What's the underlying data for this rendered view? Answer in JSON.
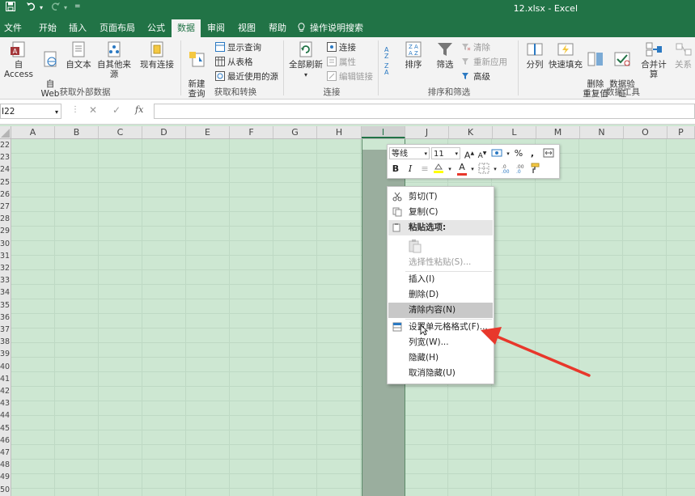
{
  "window": {
    "title": "12.xlsx  -  Excel"
  },
  "tabs": [
    {
      "label": "文件"
    },
    {
      "label": "开始"
    },
    {
      "label": "插入"
    },
    {
      "label": "页面布局"
    },
    {
      "label": "公式"
    },
    {
      "label": "数据"
    },
    {
      "label": "审阅"
    },
    {
      "label": "视图"
    },
    {
      "label": "帮助"
    },
    {
      "label": "操作说明搜索"
    }
  ],
  "active_tab": "数据",
  "ribbon": {
    "get_external": {
      "access": "自 Access",
      "web": "自\nWeb",
      "text": "自文本",
      "other": "自其他来源",
      "existing": "现有连接",
      "group_label": "获取外部数据"
    },
    "get_transform": {
      "new_query": "新建\n查询",
      "show_queries": "显示查询",
      "from_table": "从表格",
      "recent_sources": "最近使用的源",
      "group_label": "获取和转换"
    },
    "connections": {
      "refresh_all": "全部刷新",
      "connections": "连接",
      "properties": "属性",
      "edit_links": "编辑链接",
      "group_label": "连接"
    },
    "sort_filter": {
      "sort": "排序",
      "filter": "筛选",
      "clear": "清除",
      "reapply": "重新应用",
      "advanced": "高级",
      "group_label": "排序和筛选"
    },
    "data_tools": {
      "split": "分列",
      "flash_fill": "快速填充",
      "remove_dup": "删除\n重复值",
      "validation": "数据验\n证",
      "consolidate": "合并计算",
      "relationships": "关系",
      "group_label": "数据工具"
    }
  },
  "formula_bar": {
    "name_box": "I22",
    "fx": "fx"
  },
  "columns": [
    "A",
    "B",
    "C",
    "D",
    "E",
    "F",
    "G",
    "H",
    "I",
    "J",
    "K",
    "L",
    "M",
    "N",
    "O",
    "P"
  ],
  "selected_column": "I",
  "rows": [
    "22",
    "23",
    "24",
    "25",
    "26",
    "27",
    "28",
    "29",
    "30",
    "31",
    "32",
    "33",
    "34",
    "35",
    "36",
    "37",
    "38",
    "39",
    "40",
    "41",
    "42",
    "43",
    "44",
    "45",
    "46",
    "47",
    "48",
    "49",
    "50"
  ],
  "mini_toolbar": {
    "font_name": "等线",
    "font_size": "11",
    "grow": "A",
    "shrink": "A",
    "percent": "%",
    "comma": ",",
    "bold": "B",
    "italic": "I",
    "font_color_glyph": "A"
  },
  "context_menu": [
    {
      "label": "剪切(T)",
      "icon": "scissors-icon"
    },
    {
      "label": "复制(C)",
      "icon": "copy-icon"
    },
    {
      "label": "粘贴选项:",
      "icon": "paste-icon",
      "header": true
    },
    {
      "label": "选择性粘贴(S)...",
      "disabled": true
    },
    {
      "label": "插入(I)"
    },
    {
      "label": "删除(D)"
    },
    {
      "label": "清除内容(N)",
      "highlighted": true
    },
    {
      "label": "设置单元格格式(F)...",
      "icon": "format-cells-icon"
    },
    {
      "label": "列宽(W)..."
    },
    {
      "label": "隐藏(H)"
    },
    {
      "label": "取消隐藏(U)"
    }
  ],
  "colors": {
    "excel_green": "#217346",
    "sheet_bg": "#cde7d2",
    "arrow": "#e8372b"
  }
}
